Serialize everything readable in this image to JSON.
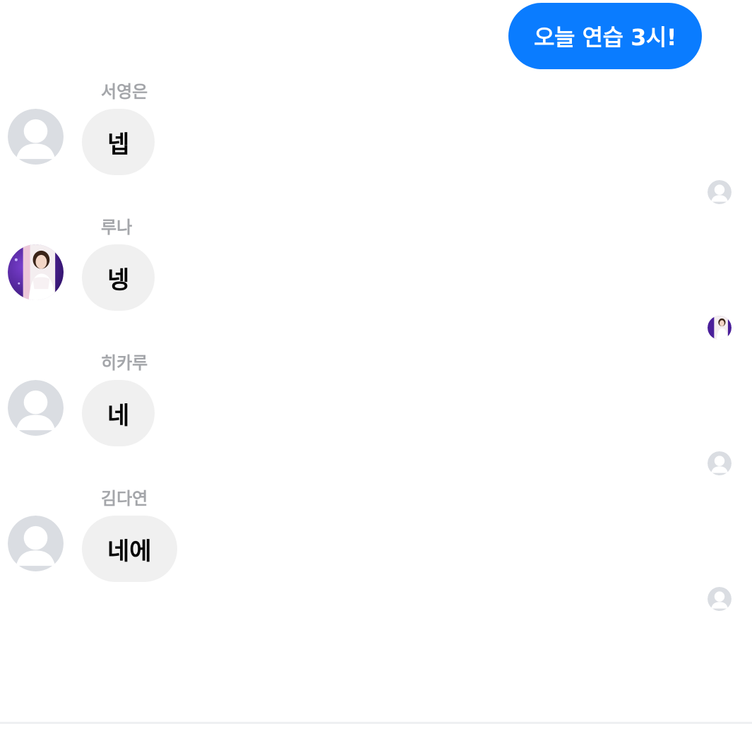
{
  "outgoing": {
    "text": "오늘 연습 3시!"
  },
  "messages": [
    {
      "sender": "서영은",
      "text": "넵",
      "avatar": "default-avatar-icon"
    },
    {
      "sender": "루나",
      "text": "넹",
      "avatar": "profile-photo"
    },
    {
      "sender": "히카루",
      "text": "네",
      "avatar": "default-avatar-icon"
    },
    {
      "sender": "김다연",
      "text": "네에",
      "avatar": "default-avatar-icon"
    }
  ],
  "colors": {
    "outgoing_bubble": "#0a7cff",
    "incoming_bubble": "#f0f0f0",
    "sender_name": "#a4a6aa",
    "default_avatar_bg": "#dadde2",
    "default_avatar_fg": "#ffffff"
  }
}
